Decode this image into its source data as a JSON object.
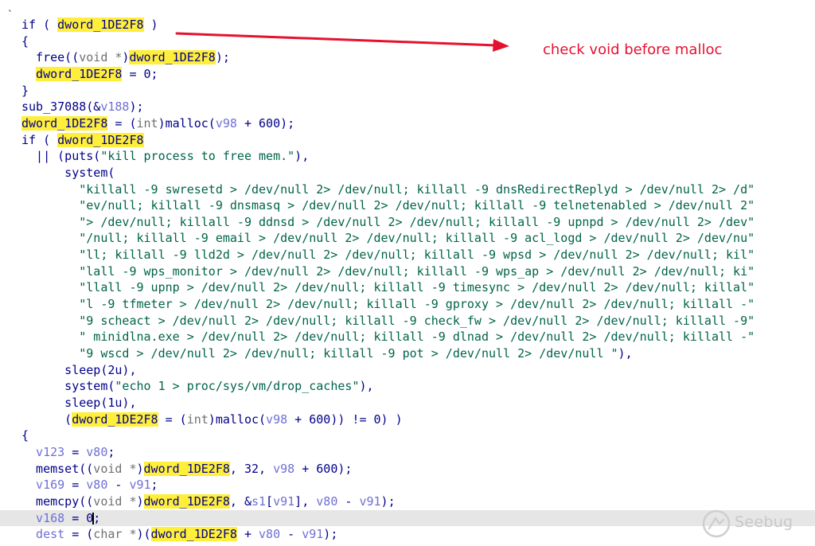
{
  "code": {
    "lines": [
      {
        "indent": 0,
        "tokens": [
          {
            "t": "if ( ",
            "c": "k"
          },
          {
            "t": "dword_1DE2F8",
            "c": "h"
          },
          {
            "t": " )",
            "c": "n"
          }
        ]
      },
      {
        "indent": 0,
        "tokens": [
          {
            "t": "{",
            "c": "n"
          }
        ]
      },
      {
        "indent": 2,
        "tokens": [
          {
            "t": "free",
            "c": "n"
          },
          {
            "t": "((",
            "c": "n"
          },
          {
            "t": "void *",
            "c": "g"
          },
          {
            "t": ")",
            "c": "n"
          },
          {
            "t": "dword_1DE2F8",
            "c": "h"
          },
          {
            "t": ");",
            "c": "n"
          }
        ]
      },
      {
        "indent": 2,
        "tokens": [
          {
            "t": "dword_1DE2F8",
            "c": "h"
          },
          {
            "t": " = 0;",
            "c": "n"
          }
        ]
      },
      {
        "indent": 0,
        "tokens": [
          {
            "t": "}",
            "c": "n"
          }
        ]
      },
      {
        "indent": 0,
        "tokens": [
          {
            "t": "sub_37088",
            "c": "n"
          },
          {
            "t": "(&",
            "c": "n"
          },
          {
            "t": "v188",
            "c": "v"
          },
          {
            "t": ");",
            "c": "n"
          }
        ]
      },
      {
        "indent": 0,
        "tokens": [
          {
            "t": "dword_1DE2F8",
            "c": "h"
          },
          {
            "t": " = (",
            "c": "n"
          },
          {
            "t": "int",
            "c": "g"
          },
          {
            "t": ")malloc(",
            "c": "n"
          },
          {
            "t": "v98",
            "c": "v"
          },
          {
            "t": " + 600);",
            "c": "n"
          }
        ]
      },
      {
        "indent": 0,
        "tokens": [
          {
            "t": "if ( ",
            "c": "k"
          },
          {
            "t": "dword_1DE2F8",
            "c": "h"
          }
        ]
      },
      {
        "indent": 2,
        "tokens": [
          {
            "t": "|| (puts(",
            "c": "n"
          },
          {
            "t": "\"kill process to free mem.\"",
            "c": "s"
          },
          {
            "t": "),",
            "c": "n"
          }
        ]
      },
      {
        "indent": 6,
        "tokens": [
          {
            "t": "system(",
            "c": "n"
          }
        ]
      },
      {
        "indent": 8,
        "tokens": [
          {
            "t": "\"killall -9 swresetd > /dev/null 2> /dev/null; killall -9 dnsRedirectReplyd > /dev/null 2> /d\"",
            "c": "s"
          }
        ]
      },
      {
        "indent": 8,
        "tokens": [
          {
            "t": "\"ev/null; killall -9 dnsmasq > /dev/null 2> /dev/null; killall -9 telnetenabled > /dev/null 2\"",
            "c": "s"
          }
        ]
      },
      {
        "indent": 8,
        "tokens": [
          {
            "t": "\"> /dev/null; killall -9 ddnsd > /dev/null 2> /dev/null; killall -9 upnpd > /dev/null 2> /dev\"",
            "c": "s"
          }
        ]
      },
      {
        "indent": 8,
        "tokens": [
          {
            "t": "\"/null; killall -9 email > /dev/null 2> /dev/null; killall -9 acl_logd > /dev/null 2> /dev/nu\"",
            "c": "s"
          }
        ]
      },
      {
        "indent": 8,
        "tokens": [
          {
            "t": "\"ll; killall -9 lld2d > /dev/null 2> /dev/null; killall -9 wpsd > /dev/null 2> /dev/null; kil\"",
            "c": "s"
          }
        ]
      },
      {
        "indent": 8,
        "tokens": [
          {
            "t": "\"lall -9 wps_monitor > /dev/null 2> /dev/null; killall -9 wps_ap > /dev/null 2> /dev/null; ki\"",
            "c": "s"
          }
        ]
      },
      {
        "indent": 8,
        "tokens": [
          {
            "t": "\"llall -9 upnp > /dev/null 2> /dev/null; killall -9 timesync > /dev/null 2> /dev/null; killal\"",
            "c": "s"
          }
        ]
      },
      {
        "indent": 8,
        "tokens": [
          {
            "t": "\"l -9 tfmeter > /dev/null 2> /dev/null; killall -9 gproxy > /dev/null 2> /dev/null; killall -\"",
            "c": "s"
          }
        ]
      },
      {
        "indent": 8,
        "tokens": [
          {
            "t": "\"9 scheact > /dev/null 2> /dev/null; killall -9 check_fw > /dev/null 2> /dev/null; killall -9\"",
            "c": "s"
          }
        ]
      },
      {
        "indent": 8,
        "tokens": [
          {
            "t": "\" minidlna.exe > /dev/null 2> /dev/null; killall -9 dlnad > /dev/null 2> /dev/null; killall -\"",
            "c": "s"
          }
        ]
      },
      {
        "indent": 8,
        "tokens": [
          {
            "t": "\"9 wscd > /dev/null 2> /dev/null; killall -9 pot > /dev/null 2> /dev/null \"",
            "c": "s"
          },
          {
            "t": "),",
            "c": "n"
          }
        ]
      },
      {
        "indent": 6,
        "tokens": [
          {
            "t": "sleep(2u),",
            "c": "n"
          }
        ]
      },
      {
        "indent": 6,
        "tokens": [
          {
            "t": "system(",
            "c": "n"
          },
          {
            "t": "\"echo 1 > proc/sys/vm/drop_caches\"",
            "c": "s"
          },
          {
            "t": "),",
            "c": "n"
          }
        ]
      },
      {
        "indent": 6,
        "tokens": [
          {
            "t": "sleep(1u),",
            "c": "n"
          }
        ]
      },
      {
        "indent": 6,
        "tokens": [
          {
            "t": "(",
            "c": "n"
          },
          {
            "t": "dword_1DE2F8",
            "c": "h"
          },
          {
            "t": " = (",
            "c": "n"
          },
          {
            "t": "int",
            "c": "g"
          },
          {
            "t": ")malloc(",
            "c": "n"
          },
          {
            "t": "v98",
            "c": "v"
          },
          {
            "t": " + 600)) != 0) )",
            "c": "n"
          }
        ]
      },
      {
        "indent": 0,
        "tokens": [
          {
            "t": "{",
            "c": "n"
          }
        ]
      },
      {
        "indent": 2,
        "tokens": [
          {
            "t": "v123",
            "c": "v"
          },
          {
            "t": " = ",
            "c": "n"
          },
          {
            "t": "v80",
            "c": "v"
          },
          {
            "t": ";",
            "c": "n"
          }
        ]
      },
      {
        "indent": 2,
        "tokens": [
          {
            "t": "memset((",
            "c": "n"
          },
          {
            "t": "void *",
            "c": "g"
          },
          {
            "t": ")",
            "c": "n"
          },
          {
            "t": "dword_1DE2F8",
            "c": "h"
          },
          {
            "t": ", 32, ",
            "c": "n"
          },
          {
            "t": "v98",
            "c": "v"
          },
          {
            "t": " + 600);",
            "c": "n"
          }
        ]
      },
      {
        "indent": 2,
        "tokens": [
          {
            "t": "v169",
            "c": "v"
          },
          {
            "t": " = ",
            "c": "n"
          },
          {
            "t": "v80",
            "c": "v"
          },
          {
            "t": " - ",
            "c": "n"
          },
          {
            "t": "v91",
            "c": "v"
          },
          {
            "t": ";",
            "c": "n"
          }
        ]
      },
      {
        "indent": 2,
        "tokens": [
          {
            "t": "memcpy((",
            "c": "n"
          },
          {
            "t": "void *",
            "c": "g"
          },
          {
            "t": ")",
            "c": "n"
          },
          {
            "t": "dword_1DE2F8",
            "c": "h"
          },
          {
            "t": ", &",
            "c": "n"
          },
          {
            "t": "s1",
            "c": "v"
          },
          {
            "t": "[",
            "c": "n"
          },
          {
            "t": "v91",
            "c": "v"
          },
          {
            "t": "], ",
            "c": "n"
          },
          {
            "t": "v80",
            "c": "v"
          },
          {
            "t": " - ",
            "c": "n"
          },
          {
            "t": "v91",
            "c": "v"
          },
          {
            "t": ");",
            "c": "n"
          }
        ]
      },
      {
        "indent": 2,
        "current": true,
        "tokens": [
          {
            "t": "v168",
            "c": "v"
          },
          {
            "t": " = ",
            "c": "n"
          },
          {
            "t": "0",
            "c": "n",
            "caret": true
          },
          {
            "t": ";",
            "c": "n"
          }
        ]
      },
      {
        "indent": 2,
        "tokens": [
          {
            "t": "dest",
            "c": "v"
          },
          {
            "t": " = (",
            "c": "n"
          },
          {
            "t": "char *",
            "c": "g"
          },
          {
            "t": ")(",
            "c": "n"
          },
          {
            "t": "dword_1DE2F8",
            "c": "h"
          },
          {
            "t": " + ",
            "c": "n"
          },
          {
            "t": "v80",
            "c": "v"
          },
          {
            "t": " - ",
            "c": "n"
          },
          {
            "t": "v91",
            "c": "v"
          },
          {
            "t": ");",
            "c": "n"
          }
        ]
      }
    ]
  },
  "annotation": {
    "text": "check void before malloc",
    "color": "#e5122f",
    "icon": "right-arrow-icon"
  },
  "watermark": {
    "text": "Seebug",
    "icon": "seebug-logo-icon"
  },
  "colors": {
    "highlight": "#ffef3a",
    "code_text": "#00008b",
    "string": "#00644a",
    "variable": "#6f6fd6",
    "current_line": "#e6e6e6"
  }
}
